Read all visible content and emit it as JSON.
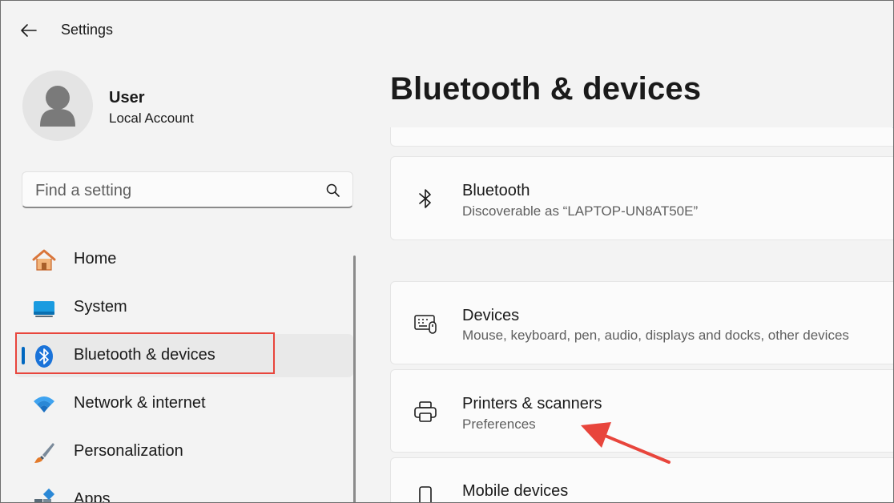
{
  "window": {
    "title": "Settings"
  },
  "user": {
    "name": "User",
    "account_type": "Local Account"
  },
  "search": {
    "placeholder": "Find a setting"
  },
  "sidebar": {
    "items": [
      {
        "label": "Home",
        "icon": "home-icon"
      },
      {
        "label": "System",
        "icon": "system-icon"
      },
      {
        "label": "Bluetooth & devices",
        "icon": "bluetooth-icon",
        "selected": true
      },
      {
        "label": "Network & internet",
        "icon": "wifi-icon"
      },
      {
        "label": "Personalization",
        "icon": "paintbrush-icon"
      },
      {
        "label": "Apps",
        "icon": "apps-icon"
      }
    ]
  },
  "main": {
    "page_title": "Bluetooth & devices",
    "cards": [
      {
        "title": "Bluetooth",
        "subtitle": "Discoverable as “LAPTOP-UN8AT50E”",
        "icon": "bluetooth-icon"
      },
      {
        "title": "Devices",
        "subtitle": "Mouse, keyboard, pen, audio, displays and docks, other devices",
        "icon": "keyboard-mouse-icon"
      },
      {
        "title": "Printers & scanners",
        "subtitle": "Preferences",
        "icon": "printer-icon"
      },
      {
        "title": "Mobile devices",
        "subtitle": "",
        "icon": "phone-icon"
      }
    ]
  },
  "colors": {
    "accent": "#0067c0",
    "highlight": "#e8453c",
    "background": "#f3f3f3",
    "card": "#fbfbfb"
  }
}
